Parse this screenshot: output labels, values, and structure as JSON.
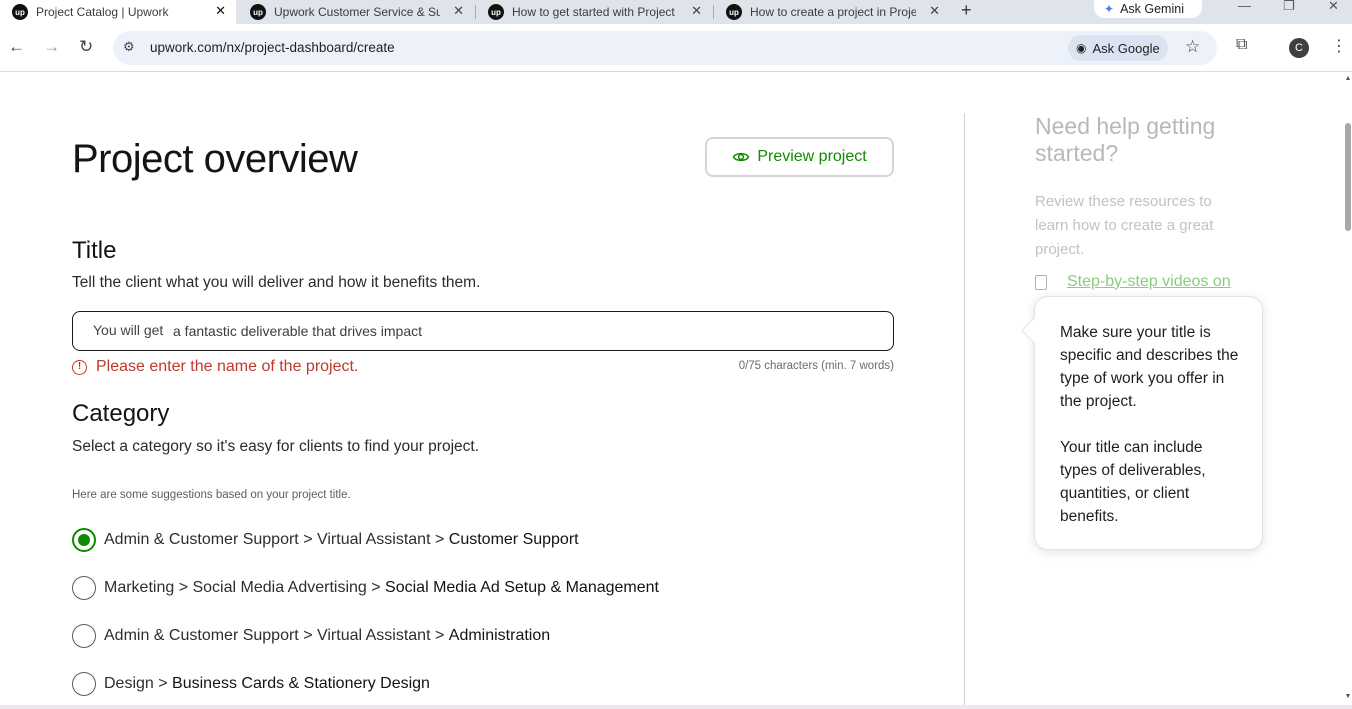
{
  "browser": {
    "tabs": [
      {
        "title": "Project Catalog | Upwork",
        "favicon": "upwork-logo",
        "active": true
      },
      {
        "title": "Upwork Customer Service & Su",
        "favicon": "upwork-logo",
        "active": false
      },
      {
        "title": "How to get started with Project",
        "favicon": "upwork-logo",
        "active": false
      },
      {
        "title": "How to create a project in Proje",
        "favicon": "upwork-logo",
        "active": false
      }
    ],
    "favicon_text": "up",
    "close_glyph": "✕",
    "new_tab_glyph": "+",
    "gemini_label": "Ask Gemini",
    "url": "upwork.com/nx/project-dashboard/create",
    "ask_google_label": "Ask Google",
    "profile_initial": "C"
  },
  "page": {
    "heading": "Project overview",
    "preview_button": "Preview project",
    "title_section": {
      "heading": "Title",
      "description": "Tell the client what you will deliver and how it benefits them.",
      "prefix": "You will get",
      "placeholder": "a fantastic deliverable that drives impact",
      "value": "",
      "error": "Please enter the name of the project.",
      "counter": "0/75 characters (min. 7 words)"
    },
    "category_section": {
      "heading": "Category",
      "description": "Select a category so it's easy for clients to find your project.",
      "suggestions_note": "Here are some suggestions based on your project title.",
      "options": [
        {
          "path": "Admin & Customer Support > Virtual Assistant > ",
          "leaf": "Customer Support",
          "checked": true
        },
        {
          "path": "Marketing > Social Media Advertising > ",
          "leaf": "Social Media Ad Setup & Management",
          "checked": false
        },
        {
          "path": "Admin & Customer Support > Virtual Assistant > ",
          "leaf": "Administration",
          "checked": false
        },
        {
          "path": "Design > ",
          "leaf": "Business Cards & Stationery Design",
          "checked": false
        }
      ]
    }
  },
  "sidebar": {
    "heading": "Need help getting started?",
    "description": "Review these resources to learn how to create a great project.",
    "link": "Step-by-step videos on",
    "tooltip": {
      "paragraph1": "Make sure your title is specific and describes the type of work you offer in the project.",
      "paragraph2": "Your title can include types of deliverables, quantities, or client benefits."
    }
  },
  "colors": {
    "accent_green": "#108a00",
    "error_red": "#c0392b"
  }
}
